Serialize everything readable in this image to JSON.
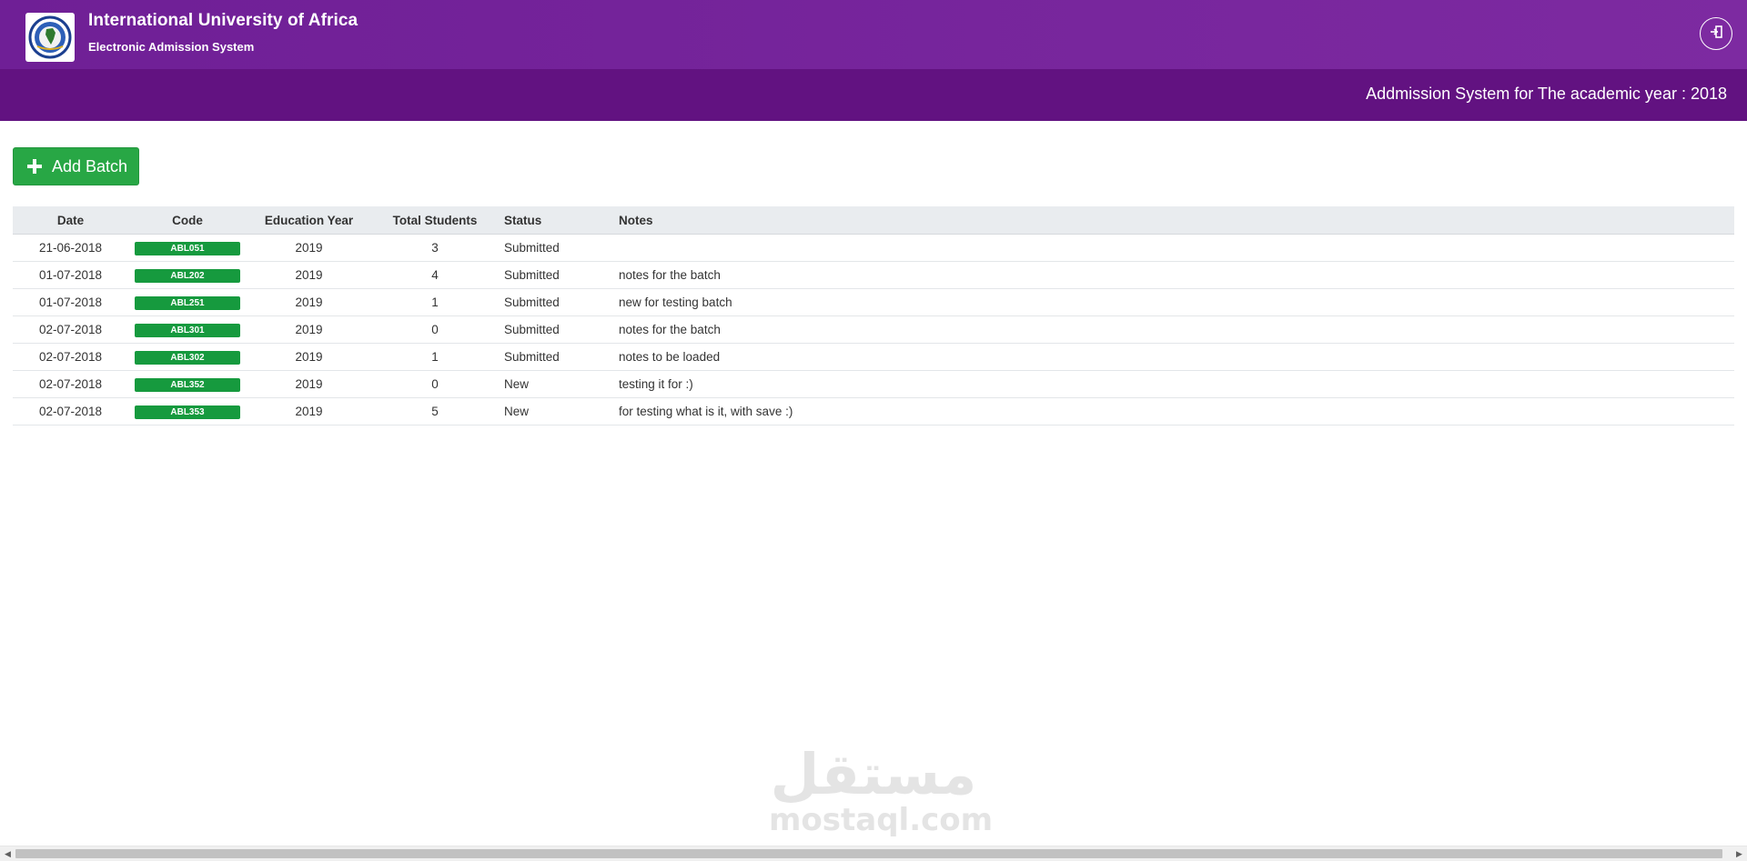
{
  "header": {
    "title": "International University of Africa",
    "subtitle": "Electronic Admission System",
    "academic_year_text": "Addmission System for The academic year : 2018",
    "logout_icon": "logout-icon"
  },
  "actions": {
    "add_batch_label": "Add Batch"
  },
  "table": {
    "headers": [
      "Date",
      "Code",
      "Education Year",
      "Total Students",
      "Status",
      "Notes"
    ],
    "rows": [
      {
        "date": "21-06-2018",
        "code": "ABL051",
        "year": "2019",
        "total": "3",
        "status": "Submitted",
        "notes": ""
      },
      {
        "date": "01-07-2018",
        "code": "ABL202",
        "year": "2019",
        "total": "4",
        "status": "Submitted",
        "notes": "notes for the batch"
      },
      {
        "date": "01-07-2018",
        "code": "ABL251",
        "year": "2019",
        "total": "1",
        "status": "Submitted",
        "notes": "new for testing batch"
      },
      {
        "date": "02-07-2018",
        "code": "ABL301",
        "year": "2019",
        "total": "0",
        "status": "Submitted",
        "notes": "notes for the batch"
      },
      {
        "date": "02-07-2018",
        "code": "ABL302",
        "year": "2019",
        "total": "1",
        "status": "Submitted",
        "notes": "notes to be loaded"
      },
      {
        "date": "02-07-2018",
        "code": "ABL352",
        "year": "2019",
        "total": "0",
        "status": "New",
        "notes": "testing it for :)"
      },
      {
        "date": "02-07-2018",
        "code": "ABL353",
        "year": "2019",
        "total": "5",
        "status": "New",
        "notes": "for testing what is it, with save :)"
      }
    ]
  },
  "watermark": {
    "arabic": "مستقل",
    "latin": "mostaql.com"
  },
  "colors": {
    "header_purple": "#7d2aa1",
    "subbar_purple": "#621281",
    "button_green": "#28a745",
    "badge_green": "#169a3e"
  }
}
